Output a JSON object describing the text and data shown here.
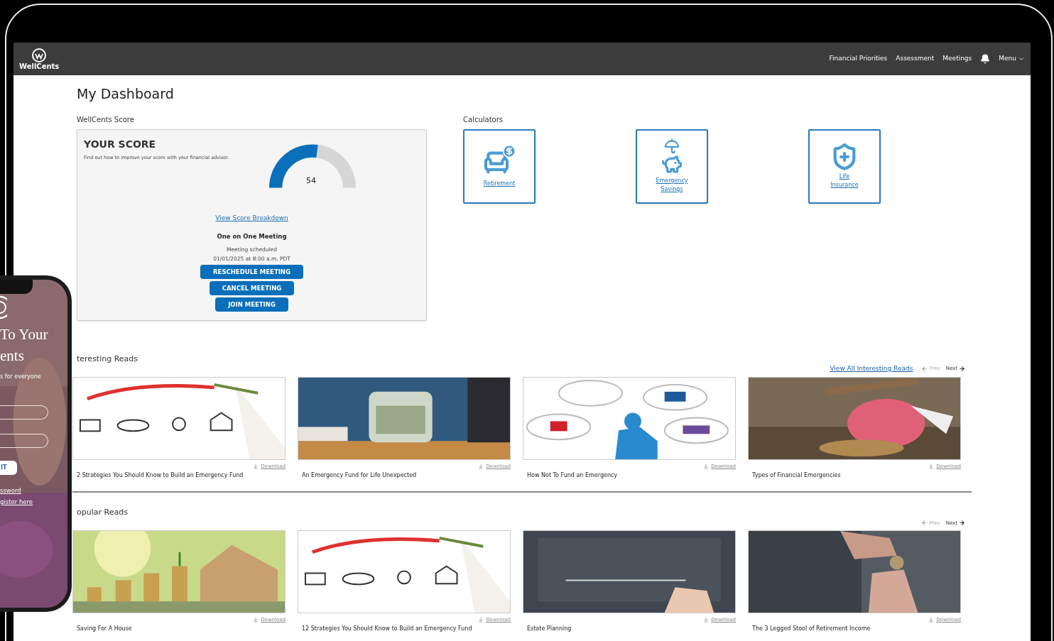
{
  "header": {
    "logo": "WellCents",
    "nav": [
      {
        "label": "Financial Priorities"
      },
      {
        "label": "Assessment"
      },
      {
        "label": "Meetings"
      }
    ],
    "menu": "Menu"
  },
  "page_title": "My Dashboard",
  "score": {
    "section_label": "WellCents Score",
    "title": "YOUR SCORE",
    "subtitle": "Find out how to improve your score with your financial advisor.",
    "level": 0.54,
    "value": "54",
    "link": "View Score Breakdown",
    "meeting_title": "One on One Meeting",
    "meeting_status": "Meeting scheduled",
    "meeting_time": "01/01/2025 at 8:00 a.m. PDT",
    "buttons": [
      "RESCHEDULE MEETING",
      "CANCEL MEETING",
      "JOIN MEETING"
    ]
  },
  "calculators": {
    "label": "Calculators",
    "items": [
      {
        "kind": "retirement",
        "label": "Retirement"
      },
      {
        "kind": "savings",
        "label": "Emergency Savings"
      },
      {
        "kind": "insurance",
        "label": "Life Insurance"
      }
    ]
  },
  "sections": [
    {
      "title": "teresting Reads",
      "view_all": "View All Interesting Reads",
      "prev": {
        "label": "Prev",
        "disabled": true
      },
      "next": {
        "label": "Next",
        "disabled": false
      },
      "cards": [
        {
          "title": "2 Strategies You Should Know to Build an Emergency Fund",
          "download": "Download"
        },
        {
          "title": "An Emergency Fund for Life Unexpected",
          "download": "Download"
        },
        {
          "title": "How Not To Fund an Emergency",
          "download": "Download"
        },
        {
          "title": "Types of Financial Emergencies",
          "download": "Download"
        }
      ]
    },
    {
      "title": "opular Reads",
      "prev": {
        "label": "Prev",
        "disabled": true
      },
      "next": {
        "label": "Next",
        "disabled": false
      },
      "cards": [
        {
          "title": "Saving For A House",
          "download": "Download"
        },
        {
          "title": "12 Strategies You Should Know to Build an Emergency Fund",
          "download": "Download"
        },
        {
          "title": "Estate Planning",
          "download": "Download"
        },
        {
          "title": "The 3 Legged Stool of Retirement Income",
          "download": "Download"
        }
      ]
    }
  ],
  "phone": {
    "heading_lines": [
      "To Your",
      "ents"
    ],
    "tagline": "s for everyone",
    "button": "IT",
    "links": [
      "ssword",
      "gister here"
    ]
  }
}
